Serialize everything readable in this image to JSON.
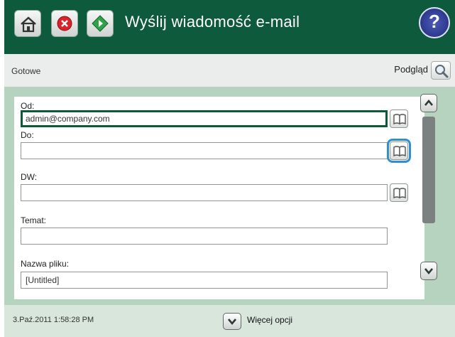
{
  "header": {
    "title": "Wyślij wiadomość e-mail",
    "help_label": "?",
    "icons": [
      "home-icon",
      "stop-icon",
      "start-icon",
      "help-icon"
    ]
  },
  "status": {
    "text": "Gotowe",
    "preview_label": "Podgląd"
  },
  "form": {
    "from_label": "Od:",
    "from_value": "admin@company.com",
    "to_label": "Do:",
    "to_value": "",
    "cc_label": "DW:",
    "cc_value": "",
    "subject_label": "Temat:",
    "subject_value": "",
    "filename_label": "Nazwa pliku:",
    "filename_value": "[Untitled]"
  },
  "footer": {
    "datetime": "3.Paź.2011 1:58:28 PM",
    "more_options": "Więcej opcji"
  },
  "colors": {
    "header_bg": "#0e5a3c",
    "panel_bg": "#b5d3bf",
    "active_field_border": "#0d5a3b",
    "focus_outline": "#2f8fd1"
  }
}
